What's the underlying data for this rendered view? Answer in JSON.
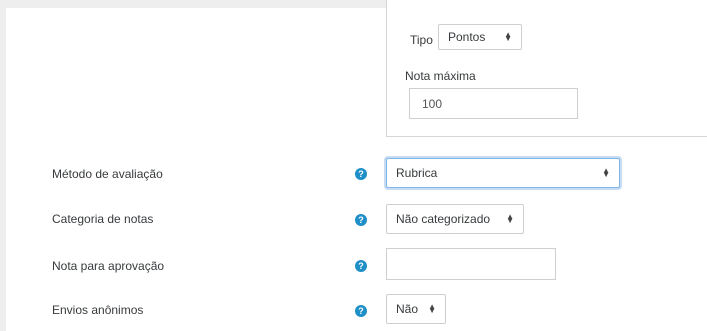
{
  "grade": {
    "tipo_label": "Tipo",
    "tipo_value": "Pontos",
    "nota_maxima_label": "Nota máxima",
    "nota_maxima_value": "100"
  },
  "rows": [
    {
      "label": "Método de avaliação",
      "control": "select",
      "value": "Rubrica"
    },
    {
      "label": "Categoria de notas",
      "control": "select",
      "value": "Não categorizado"
    },
    {
      "label": "Nota para aprovação",
      "control": "input",
      "value": ""
    },
    {
      "label": "Envios anônimos",
      "control": "select",
      "value": "Não"
    }
  ],
  "help_icon_glyph": "?",
  "colors": {
    "help_icon": "#1f8fc7",
    "focus_ring": "#7fb7e8",
    "background": "#eeeeee"
  }
}
